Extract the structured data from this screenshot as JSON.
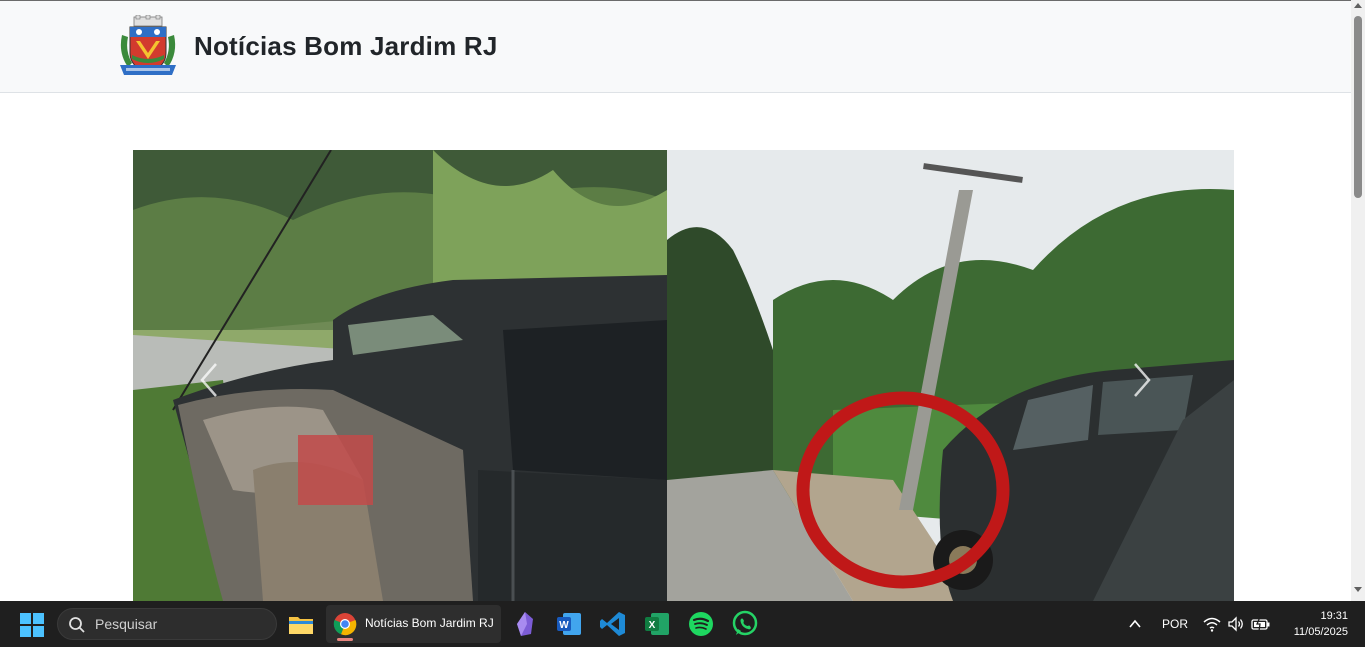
{
  "site": {
    "title": "Notícias Bom Jardim RJ",
    "logo_icon": "municipal-coat-of-arms-icon"
  },
  "carousel": {
    "image_description_icon": "news-photo",
    "prev_icon": "chevron-left-icon",
    "next_icon": "chevron-right-icon"
  },
  "taskbar": {
    "search_placeholder": "Pesquisar",
    "active_window_title": "Notícias Bom Jardim RJ",
    "pinned_apps": [
      "file-explorer-icon",
      "chrome-icon",
      "obsidian-icon",
      "word-icon",
      "vscode-icon",
      "excel-icon",
      "spotify-icon",
      "whatsapp-icon"
    ],
    "language": "POR",
    "time": "19:31",
    "date": "11/05/2025"
  },
  "colors": {
    "navbar_bg": "#f8f9fa",
    "taskbar_bg": "#1f1f1f",
    "title_text": "#212529"
  }
}
